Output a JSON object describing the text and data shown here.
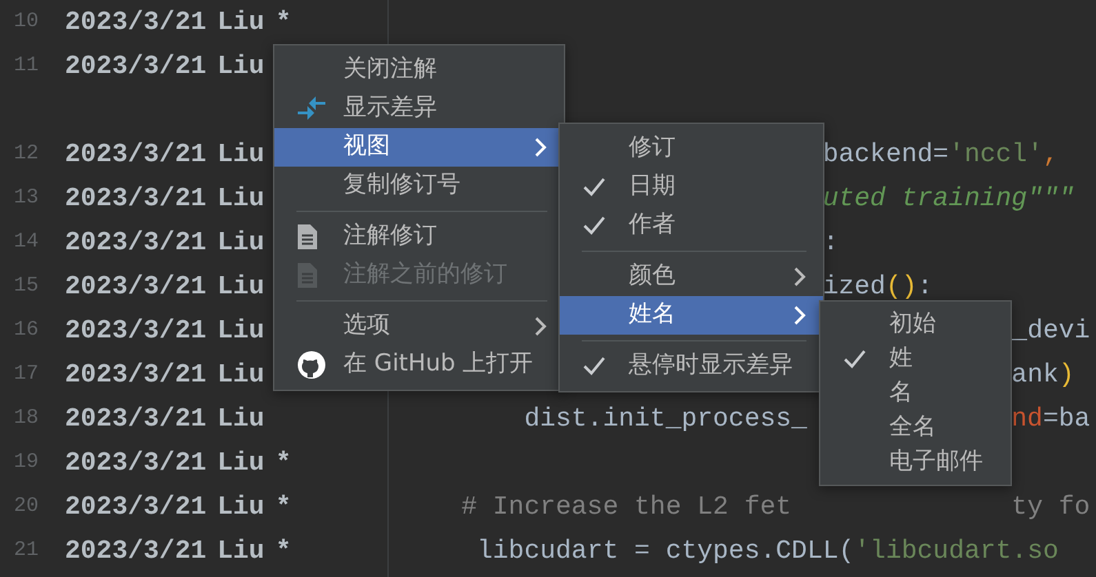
{
  "annotations": [
    {
      "line": "10",
      "date": "2023/3/21",
      "author": "Liu",
      "mark": "*"
    },
    {
      "line": "11",
      "date": "2023/3/21",
      "author": "Liu"
    },
    {
      "line": "12",
      "date": "2023/3/21",
      "author": "Liu"
    },
    {
      "line": "13",
      "date": "2023/3/21",
      "author": "Liu"
    },
    {
      "line": "14",
      "date": "2023/3/21",
      "author": "Liu"
    },
    {
      "line": "15",
      "date": "2023/3/21",
      "author": "Liu"
    },
    {
      "line": "16",
      "date": "2023/3/21",
      "author": "Liu"
    },
    {
      "line": "17",
      "date": "2023/3/21",
      "author": "Liu"
    },
    {
      "line": "18",
      "date": "2023/3/21",
      "author": "Liu"
    },
    {
      "line": "19",
      "date": "2023/3/21",
      "author": "Liu",
      "mark": "*"
    },
    {
      "line": "20",
      "date": "2023/3/21",
      "author": "Liu",
      "mark": "*"
    },
    {
      "line": "21",
      "date": "2023/3/21",
      "author": "Liu",
      "mark": "*"
    }
  ],
  "code_lines": [
    {
      "kind": "blank"
    },
    {
      "kind": "blank"
    },
    {
      "kind": "blank"
    },
    {
      "fragments": [
        [
          {
            "text": "backend=",
            "kind": "plain"
          },
          {
            "text": "'nccl'",
            "kind": "string"
          },
          {
            "text": ",",
            "kind": "punct"
          }
        ]
      ]
    },
    {
      "fragments": [
        [
          {
            "text": "uted training\"\"\"",
            "kind": "docstring"
          }
        ]
      ]
    },
    {
      "fragments": [
        [
          {
            "text": ":",
            "kind": "plain"
          }
        ]
      ]
    },
    {
      "fragments": [
        [
          {
            "text": "ized",
            "kind": "plain"
          },
          {
            "text": "()",
            "kind": "paren"
          },
          {
            "text": ":",
            "kind": "plain"
          }
        ]
      ]
    },
    {
      "fragments": [
        [
          {
            "text": "_devi",
            "kind": "plain"
          }
        ]
      ]
    },
    {
      "fragments": [
        [
          {
            "text": "ank",
            "kind": "plain"
          },
          {
            "text": ")",
            "kind": "paren"
          }
        ]
      ]
    },
    {
      "fragments": [
        [
          {
            "text": "dist.init_process_",
            "kind": "plain"
          }
        ],
        [
          {
            "text": "nd",
            "kind": "param"
          },
          {
            "text": "=ba",
            "kind": "plain"
          }
        ]
      ]
    },
    {
      "kind": "blank"
    },
    {
      "fragments": [
        [
          {
            "text": "# Increase the L2 fet",
            "kind": "comment"
          }
        ],
        [
          {
            "text": "ty fo",
            "kind": "comment"
          }
        ]
      ]
    },
    {
      "fragments": [
        [
          {
            "text": "libcudart = ctypes.CDLL(",
            "kind": "plain"
          },
          {
            "text": "'libcudart.so",
            "kind": "string"
          }
        ]
      ]
    }
  ],
  "context_menu": [
    {
      "kind": "plain",
      "label": "关闭注解",
      "selected": false,
      "disabled": false
    },
    {
      "kind": "diff",
      "label": "显示差异",
      "selected": false,
      "disabled": false
    },
    {
      "kind": "submenu",
      "label": "视图",
      "selected": true,
      "disabled": false
    },
    {
      "kind": "plain",
      "label": "复制修订号",
      "selected": false,
      "disabled": false
    },
    {
      "kind": "separator"
    },
    {
      "kind": "document",
      "label": "注解修订",
      "selected": false,
      "disabled": false
    },
    {
      "kind": "document",
      "label": "注解之前的修订",
      "selected": false,
      "disabled": true
    },
    {
      "kind": "separator"
    },
    {
      "kind": "submenu",
      "label": "选项",
      "selected": false,
      "disabled": false
    },
    {
      "kind": "github",
      "label": "在 GitHub 上打开",
      "selected": false,
      "disabled": false
    }
  ],
  "view_submenu": [
    {
      "kind": "check",
      "label": "修订",
      "checked": false,
      "selected": false
    },
    {
      "kind": "check",
      "label": "日期",
      "checked": true,
      "selected": false
    },
    {
      "kind": "check",
      "label": "作者",
      "checked": true,
      "selected": false
    },
    {
      "kind": "separator"
    },
    {
      "kind": "submenu",
      "label": "颜色",
      "selected": false
    },
    {
      "kind": "submenu",
      "label": "姓名",
      "selected": true
    },
    {
      "kind": "separator"
    },
    {
      "kind": "check",
      "label": "悬停时显示差异",
      "checked": true,
      "selected": false
    }
  ],
  "name_submenu": [
    {
      "kind": "check",
      "label": "初始",
      "checked": false,
      "selected": false
    },
    {
      "kind": "check",
      "label": "姓",
      "checked": true,
      "selected": false
    },
    {
      "kind": "check",
      "label": "名",
      "checked": false,
      "selected": false
    },
    {
      "kind": "check",
      "label": "全名",
      "checked": false,
      "selected": false
    },
    {
      "kind": "check",
      "label": "电子邮件",
      "checked": false,
      "selected": false
    }
  ]
}
